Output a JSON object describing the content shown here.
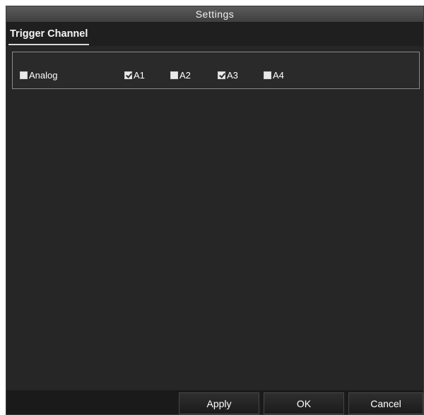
{
  "window": {
    "title": "Settings"
  },
  "tabs": [
    {
      "label": "Trigger Channel",
      "active": true
    }
  ],
  "channels": {
    "group_label": "Analog",
    "group_checked": false,
    "items": [
      {
        "label": "A1",
        "checked": true
      },
      {
        "label": "A2",
        "checked": false
      },
      {
        "label": "A3",
        "checked": true
      },
      {
        "label": "A4",
        "checked": false
      }
    ]
  },
  "footer": {
    "apply_label": "Apply",
    "ok_label": "OK",
    "cancel_label": "Cancel"
  },
  "colors": {
    "background": "#262626",
    "titlebar": "#4a4a4a",
    "text": "#ffffff"
  }
}
